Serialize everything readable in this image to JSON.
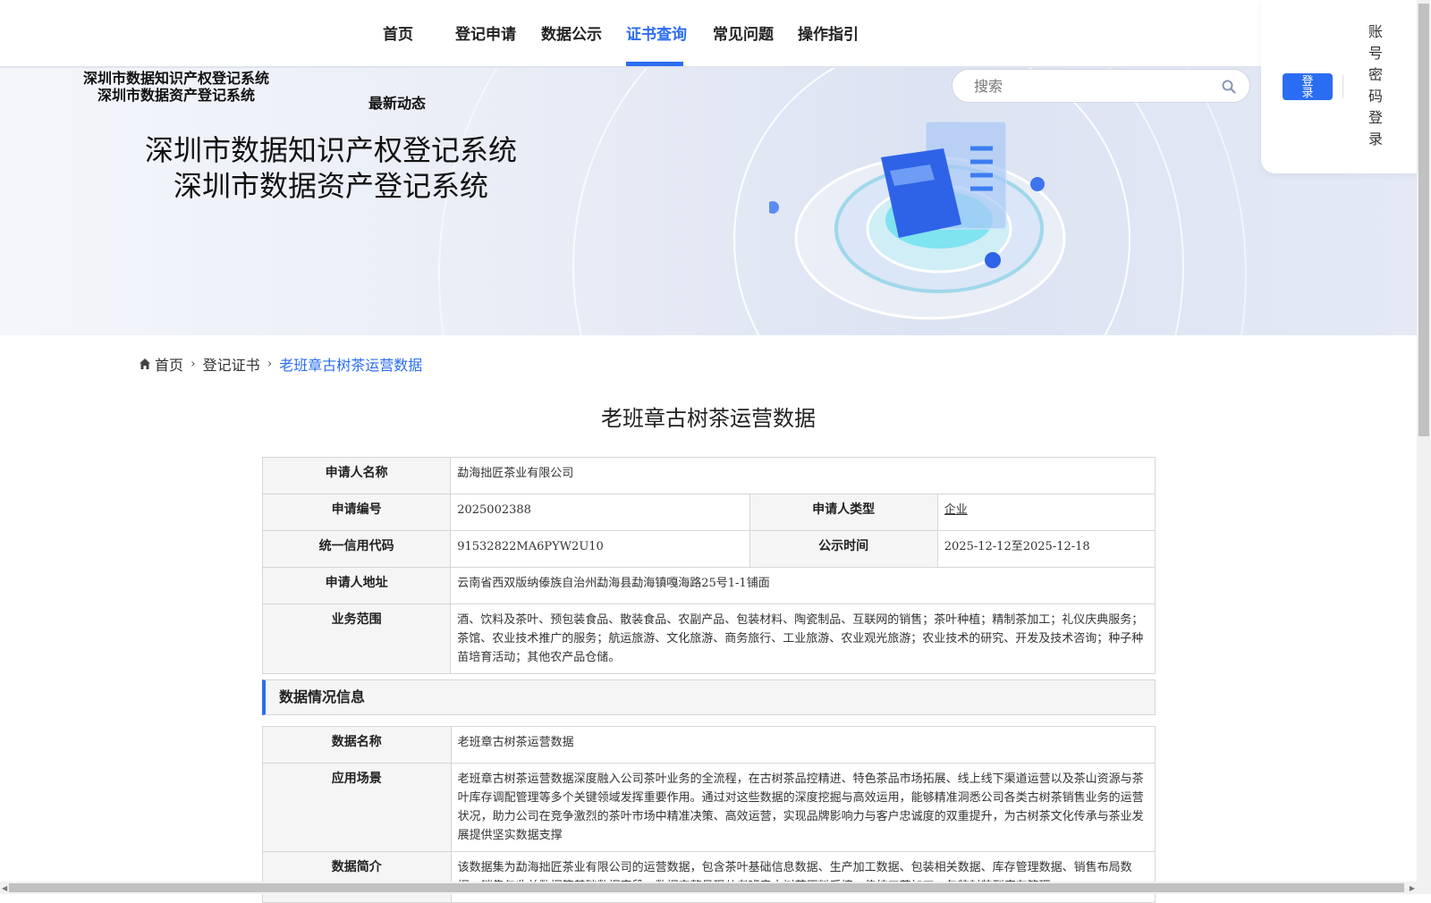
{
  "nav": {
    "items": [
      "首页",
      "登记申请",
      "数据公示",
      "证书查询",
      "常见问题",
      "操作指引"
    ],
    "active": "证书查询"
  },
  "banner": {
    "logo_line1": "深圳市数据知识产权登记系统",
    "logo_line2": "深圳市数据资产登记系统",
    "latest_news": "最新动态",
    "hero_line1": "深圳市数据知识产权登记系统",
    "hero_line2": "深圳市数据资产登记系统"
  },
  "search": {
    "placeholder": "搜索",
    "icon": "search-icon"
  },
  "login": {
    "button": "登录",
    "password_login": "账号密码登录"
  },
  "breadcrumb": {
    "home": "首页",
    "level2": "登记证书",
    "current": "老班章古树茶运营数据"
  },
  "page_title": "老班章古树茶运营数据",
  "applicant": {
    "name_label": "申请人名称",
    "name": "勐海拙匠茶业有限公司",
    "number_label": "申请编号",
    "number": "2025002388",
    "type_label": "申请人类型",
    "type": "企业",
    "credit_label": "统一信用代码",
    "credit": "91532822MA6PYW2U10",
    "publish_label": "公示时间",
    "publish": "2025-12-12至2025-12-18",
    "address_label": "申请人地址",
    "address": "云南省西双版纳傣族自治州勐海县勐海镇嘎海路25号1-1铺面",
    "scope_label": "业务范围",
    "scope": "酒、饮料及茶叶、预包装食品、散装食品、农副产品、包装材料、陶瓷制品、互联网的销售；茶叶种植；精制茶加工；礼仪庆典服务；茶馆、农业技术推广的服务；航运旅游、文化旅游、商务旅行、工业旅游、农业观光旅游；农业技术的研究、开发及技术咨询；种子种苗培育活动；其他农产品仓储。"
  },
  "data_section": {
    "title": "数据情况信息",
    "data_name_label": "数据名称",
    "data_name": "老班章古树茶运营数据",
    "scenario_label": "应用场景",
    "scenario": "老班章古树茶运营数据深度融入公司茶叶业务的全流程，在古树茶品控精进、特色茶品市场拓展、线上线下渠道运营以及茶山资源与茶叶库存调配管理等多个关键领域发挥重要作用。通过对这些数据的深度挖掘与高效运用，能够精准洞悉公司各类古树茶销售业务的运营状况，助力公司在竞争激烈的茶叶市场中精准决策、高效运营，实现品牌影响力与客户忠诚度的双重提升，为古树茶文化传承与茶业发展提供坚实数据支撑",
    "intro_label": "数据简介",
    "intro": "该数据集为勐海拙匠茶业有限公司的运营数据，包含茶叶基础信息数据、生产加工数据、包装相关数据、库存管理数据、销售布局数据、销售与收益数据等基础数据字段。数据完整呈现从老班章古树茶原料采摘、传统工艺加工、包装封装到库存管理、"
  },
  "colors": {
    "accent": "#2b6df2",
    "label_bg": "#f5f5f5",
    "border": "#d6d6d6"
  }
}
